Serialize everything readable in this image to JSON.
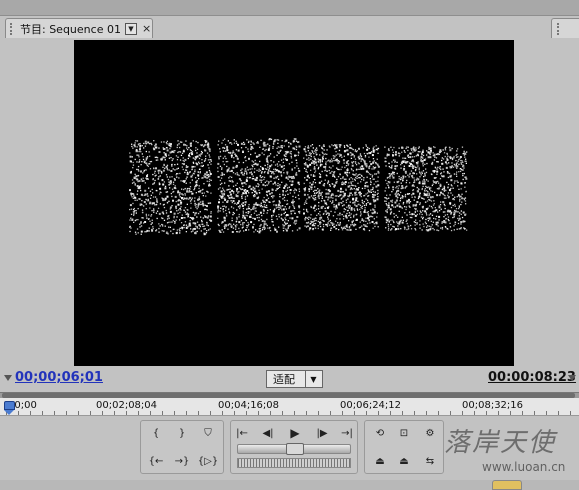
{
  "panel": {
    "tab_title": "节目: Sequence 01",
    "tab_menu_icon": "dropdown-arrow",
    "tab_close_glyph": "×"
  },
  "timecode": {
    "current": "00;00;06;01",
    "duration": "00:00:08:23",
    "fit_value": "适配"
  },
  "ruler": {
    "labels": [
      "00;00",
      "00;02;08;04",
      "00;04;16;08",
      "00;06;24;12",
      "00;08;32;16"
    ],
    "playhead_position": 0
  },
  "transport": {
    "icons": {
      "mark_in": "mark-in-icon",
      "mark_out": "mark-out-icon",
      "set_marker": "marker-icon",
      "go_to_in": "go-to-in-icon",
      "step_back": "step-back-icon",
      "play": "play-icon",
      "step_forward": "step-forward-icon",
      "go_to_out": "go-to-out-icon",
      "go_prev_marker": "go-prev-marker-icon",
      "go_next_marker": "go-next-marker-icon",
      "play_in_to_out": "play-in-out-icon",
      "loop": "loop-icon",
      "safe_margins": "safe-margins-icon",
      "output": "output-icon",
      "lift": "lift-icon",
      "extract": "extract-icon",
      "trim": "trim-icon"
    },
    "jog_level": 0.5
  },
  "watermark": {
    "text": "落岸天使",
    "url": "www.luoan.cn"
  },
  "colors": {
    "timecode_blue": "#2233bb",
    "playhead_blue": "#4a7bd0",
    "panel_gray": "#c2c2c2",
    "video_bg": "#000000",
    "particle_white": "#ffffff"
  }
}
